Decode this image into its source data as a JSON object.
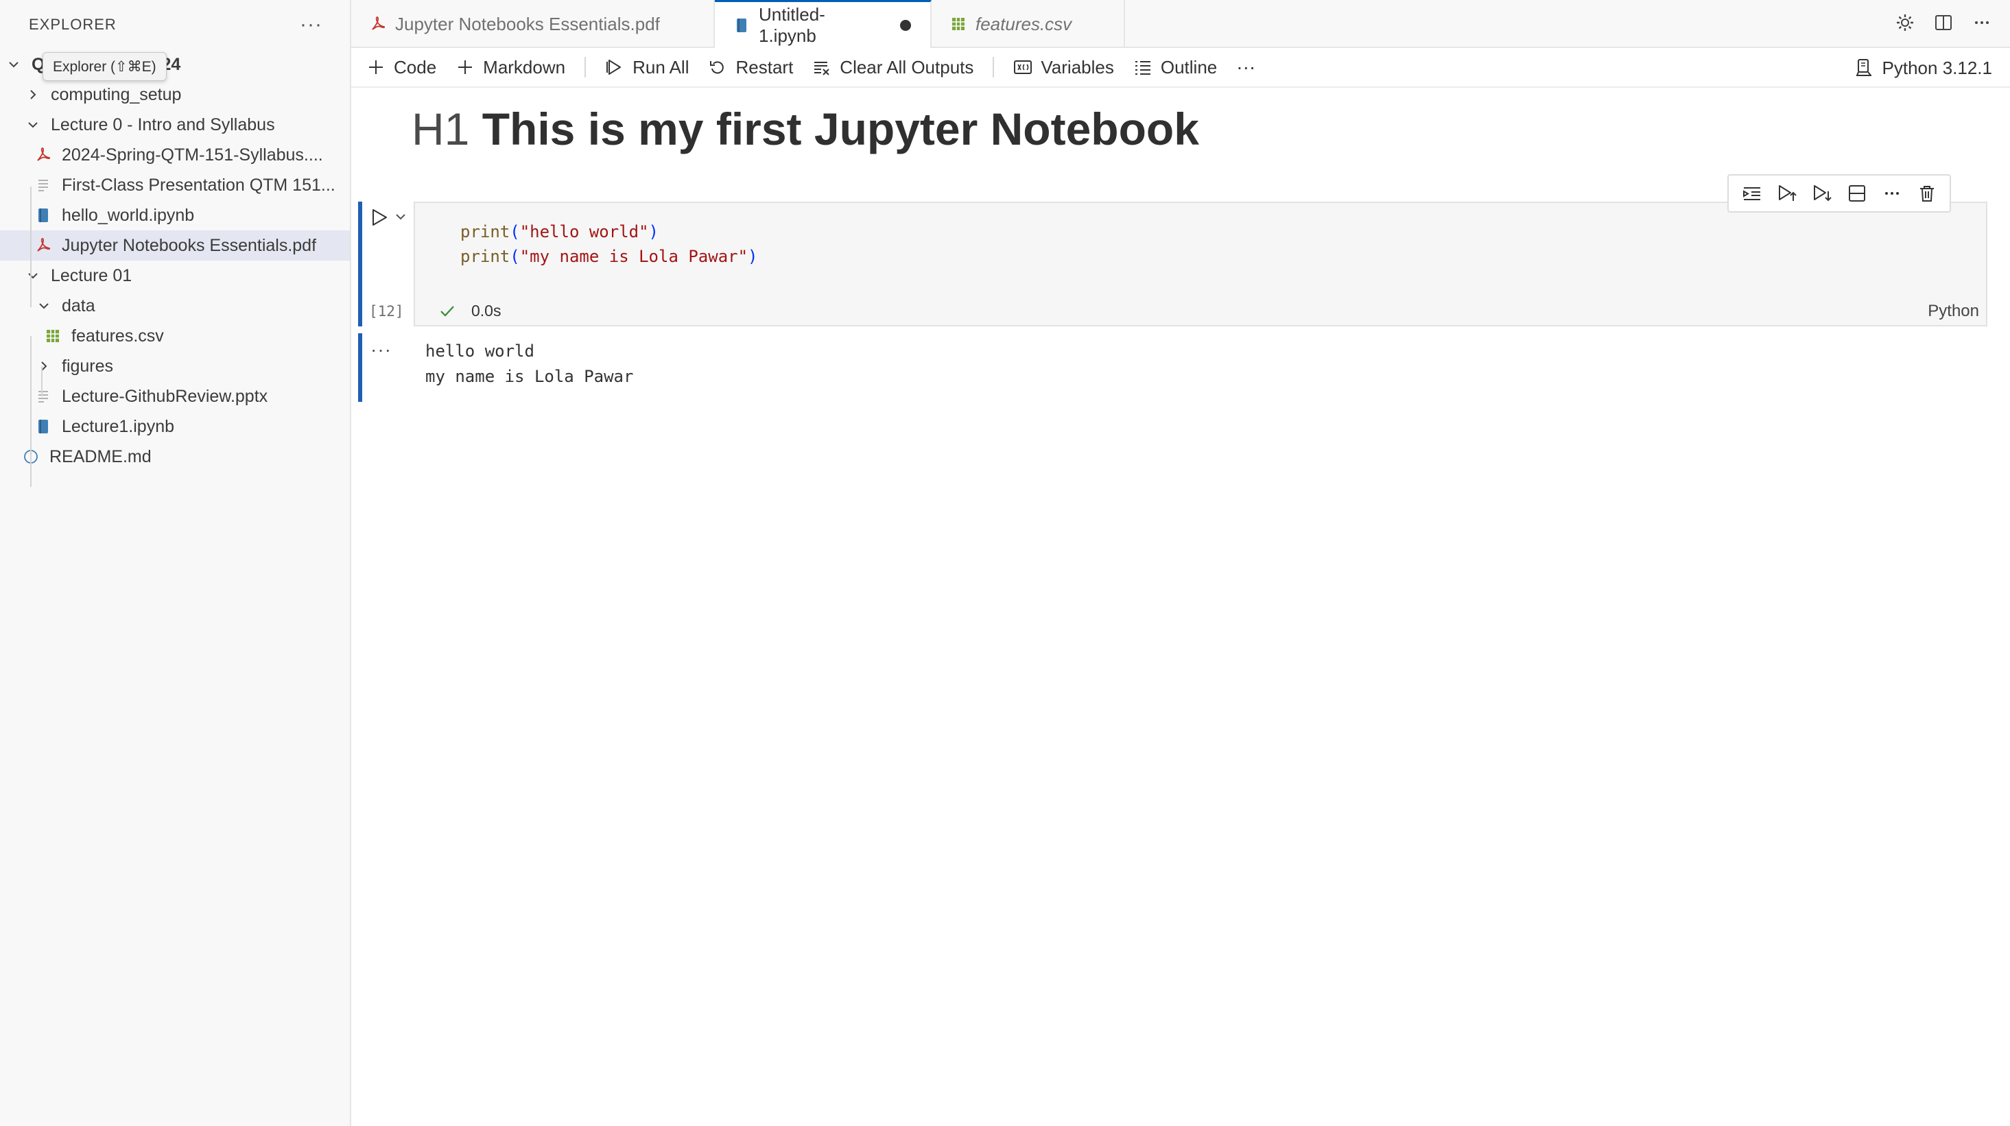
{
  "sidebar": {
    "title": "EXPLORER",
    "more_label": "···",
    "tooltip": "Explorer (⇧⌘E)",
    "root_visible_start": "Q",
    "root_visible_end": "24",
    "items": [
      {
        "label": "computing_setup",
        "kind": "folder",
        "expanded": false
      },
      {
        "label": "Lecture 0 - Intro and Syllabus",
        "kind": "folder",
        "expanded": true
      },
      {
        "label": "2024-Spring-QTM-151-Syllabus....",
        "kind": "pdf"
      },
      {
        "label": "First-Class Presentation QTM 151...",
        "kind": "text"
      },
      {
        "label": "hello_world.ipynb",
        "kind": "notebook"
      },
      {
        "label": "Jupyter Notebooks Essentials.pdf",
        "kind": "pdf",
        "selected": true
      },
      {
        "label": "Lecture 01",
        "kind": "folder",
        "expanded": true
      },
      {
        "label": "data",
        "kind": "folder",
        "expanded": true
      },
      {
        "label": "features.csv",
        "kind": "csv"
      },
      {
        "label": "figures",
        "kind": "folder",
        "expanded": false
      },
      {
        "label": "Lecture-GithubReview.pptx",
        "kind": "text"
      },
      {
        "label": "Lecture1.ipynb",
        "kind": "notebook"
      },
      {
        "label": "README.md",
        "kind": "info"
      }
    ]
  },
  "tabs": [
    {
      "label": "Jupyter Notebooks Essentials.pdf",
      "icon": "pdf-icon"
    },
    {
      "label": "Untitled-1.ipynb",
      "icon": "notebook-icon",
      "active": true,
      "modified": true
    },
    {
      "label": "features.csv",
      "icon": "csv-icon",
      "italic": true
    }
  ],
  "toolbar": {
    "code": "Code",
    "markdown": "Markdown",
    "run_all": "Run All",
    "restart": "Restart",
    "clear_outputs": "Clear All Outputs",
    "variables": "Variables",
    "outline": "Outline",
    "more": "···",
    "kernel": "Python 3.12.1"
  },
  "notebook": {
    "heading_prefix": "H1",
    "heading_text": "This is my first Jupyter Notebook",
    "cell": {
      "code_lines": [
        {
          "fn": "print",
          "open": "(",
          "str": "\"hello world\"",
          "close": ")"
        },
        {
          "fn": "print",
          "open": "(",
          "str": "\"my name is Lola Pawar\"",
          "close": ")"
        }
      ],
      "exec_count": "[12]",
      "duration": "0.0s",
      "language": "Python"
    },
    "output_dots": "···",
    "output": "hello world\nmy name is Lola Pawar"
  },
  "colors": {
    "accent": "#005fb8",
    "cell_bar": "#1f5fb3",
    "pdf": "#c5362e",
    "csv": "#7aa63d",
    "notebook": "#3f7fb6",
    "success": "#388a34"
  }
}
